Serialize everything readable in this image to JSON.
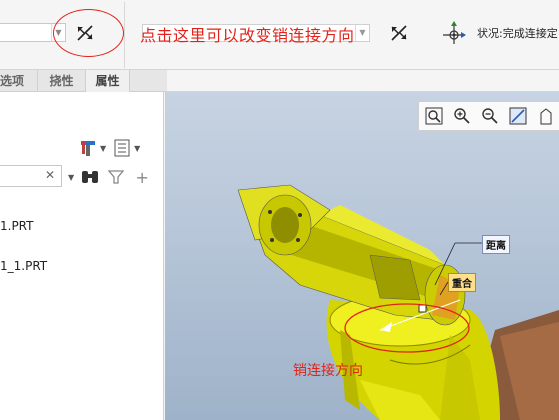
{
  "toolbar": {
    "annotation_top": "点击这里可以改变销连接方向",
    "status_text": "状况:完成连接定",
    "flip_icon": "flip-direction-icon",
    "status_icon": "constraint-status-icon"
  },
  "tabs": [
    {
      "label": "选项"
    },
    {
      "label": "挠性"
    },
    {
      "label": "属性"
    }
  ],
  "tree": {
    "items": [
      {
        "label": "1.PRT"
      },
      {
        "label": "1_1.PRT"
      }
    ]
  },
  "model": {
    "callouts": {
      "distance": "距离",
      "coincident": "重合"
    },
    "annotation_bottom": "销连接方向"
  },
  "colors": {
    "annotation": "#e2231a",
    "model_yellow": "#e6e61a",
    "viewport_bg": "#b8c7d9",
    "pedestal": "#9a6a4a"
  }
}
